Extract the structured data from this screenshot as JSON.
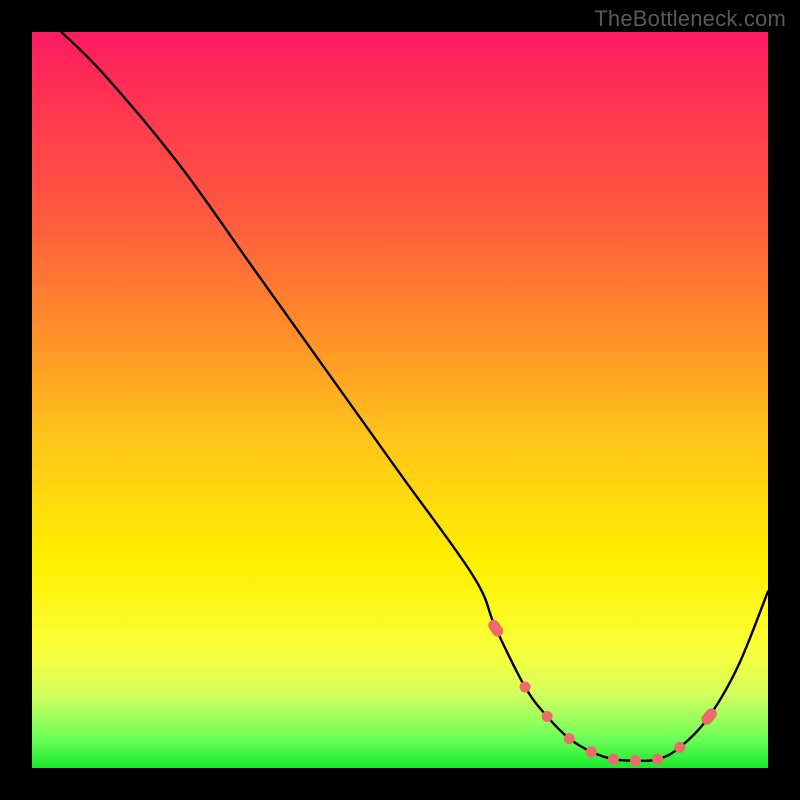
{
  "watermark": "TheBottleneck.com",
  "chart_data": {
    "type": "line",
    "title": "",
    "xlabel": "",
    "ylabel": "",
    "xlim": [
      0,
      100
    ],
    "ylim": [
      0,
      100
    ],
    "grid": false,
    "series": [
      {
        "name": "bottleneck-curve",
        "x": [
          4,
          10,
          20,
          30,
          40,
          50,
          60,
          63,
          67,
          70,
          73,
          76,
          79,
          82,
          85,
          88,
          92,
          96,
          100
        ],
        "values": [
          100,
          94,
          82,
          68,
          54,
          40,
          26,
          19,
          11,
          7,
          4,
          2.2,
          1.2,
          1.0,
          1.2,
          2.8,
          7,
          14,
          24
        ]
      }
    ],
    "markers": {
      "name": "highlighted-points",
      "color": "#ef6a6a",
      "x": [
        63,
        67,
        70,
        73,
        76,
        79,
        82,
        85,
        88,
        92
      ],
      "values": [
        19,
        11,
        7,
        4,
        2.2,
        1.2,
        1.0,
        1.2,
        2.8,
        7
      ]
    },
    "background_gradient": {
      "top": "#ff1a62",
      "mid": "#fff000",
      "bottom": "#18e82a"
    }
  }
}
